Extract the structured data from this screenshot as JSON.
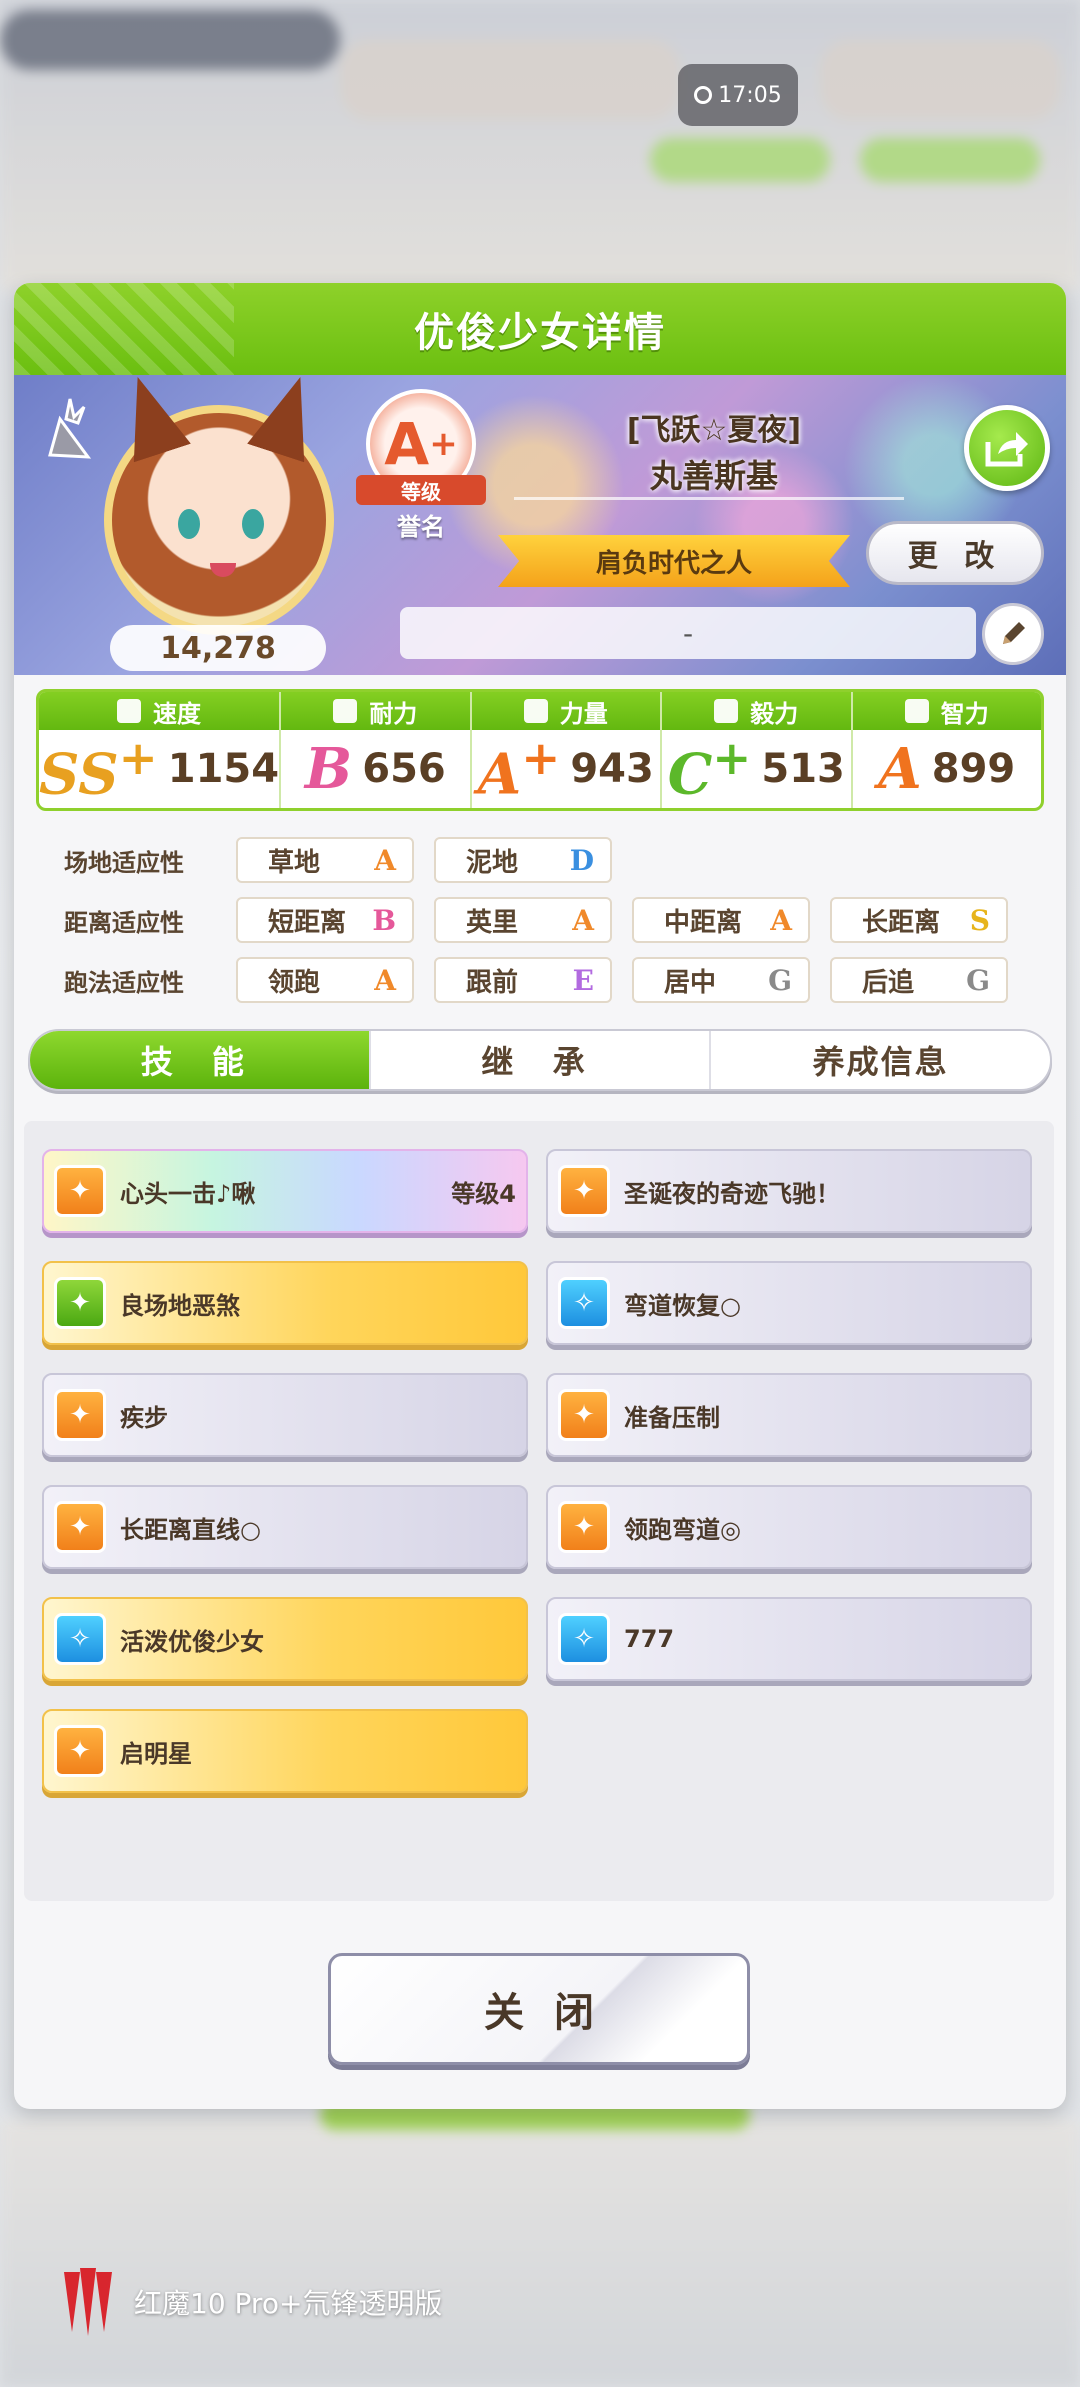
{
  "status_bar": {
    "time": "17:05"
  },
  "dialog": {
    "title": "优俊少女详情",
    "character": {
      "fans": "14,278",
      "rank": {
        "grade": "A",
        "plus": "+",
        "ribbon": "等级",
        "label": "誉名"
      },
      "outfit": "[飞跃☆夏夜]",
      "name": "丸善斯基",
      "title": "肩负时代之人",
      "change_label": "更 改",
      "comment": "-"
    },
    "stats": [
      {
        "label": "速度",
        "grade": "SS",
        "plus": "+",
        "value": "1154",
        "color": "#e8a020"
      },
      {
        "label": "耐力",
        "grade": "B",
        "plus": "",
        "value": "656",
        "color": "#e5589a"
      },
      {
        "label": "力量",
        "grade": "A",
        "plus": "+",
        "value": "943",
        "color": "#f0731e"
      },
      {
        "label": "毅力",
        "grade": "C",
        "plus": "+",
        "value": "513",
        "color": "#5cb82a"
      },
      {
        "label": "智力",
        "grade": "A",
        "plus": "",
        "value": "899",
        "color": "#f0731e"
      }
    ],
    "aptitude": {
      "track": {
        "label": "场地适应性",
        "items": [
          {
            "name": "草地",
            "grade": "A",
            "color": "#f0892a"
          },
          {
            "name": "泥地",
            "grade": "D",
            "color": "#3a8fe0"
          }
        ]
      },
      "distance": {
        "label": "距离适应性",
        "items": [
          {
            "name": "短距离",
            "grade": "B",
            "color": "#e5589a"
          },
          {
            "name": "英里",
            "grade": "A",
            "color": "#f0892a"
          },
          {
            "name": "中距离",
            "grade": "A",
            "color": "#f0892a"
          },
          {
            "name": "长距离",
            "grade": "S",
            "color": "#e7b41c"
          }
        ]
      },
      "style": {
        "label": "跑法适应性",
        "items": [
          {
            "name": "领跑",
            "grade": "A",
            "color": "#f0892a"
          },
          {
            "name": "跟前",
            "grade": "E",
            "color": "#b26be0"
          },
          {
            "name": "居中",
            "grade": "G",
            "color": "#8a8a8a"
          },
          {
            "name": "后追",
            "grade": "G",
            "color": "#8a8a8a"
          }
        ]
      }
    },
    "tabs": [
      "技 能",
      "继 承",
      "养成信息"
    ],
    "skills": [
      {
        "name": "心头一击♪啾",
        "level": "等级4",
        "style": "rainbow",
        "icon": "orange"
      },
      {
        "name": "圣诞夜的奇迹飞驰！",
        "level": "",
        "style": "silver",
        "icon": "orange"
      },
      {
        "name": "良场地恶煞",
        "level": "",
        "style": "gold",
        "icon": "green"
      },
      {
        "name": "弯道恢复○",
        "level": "",
        "style": "silver",
        "icon": "blue"
      },
      {
        "name": "疾步",
        "level": "",
        "style": "silver",
        "icon": "orange"
      },
      {
        "name": "准备压制",
        "level": "",
        "style": "silver",
        "icon": "orange"
      },
      {
        "name": "长距离直线○",
        "level": "",
        "style": "silver",
        "icon": "orange"
      },
      {
        "name": "领跑弯道◎",
        "level": "",
        "style": "silver",
        "icon": "orange"
      },
      {
        "name": "活泼优俊少女",
        "level": "",
        "style": "gold",
        "icon": "blue"
      },
      {
        "name": "777",
        "level": "",
        "style": "silver",
        "icon": "blue"
      },
      {
        "name": "启明星",
        "level": "",
        "style": "gold",
        "icon": "orange"
      }
    ],
    "close_label": "关闭"
  },
  "watermark": "红魔10 Pro+氘锋透明版"
}
